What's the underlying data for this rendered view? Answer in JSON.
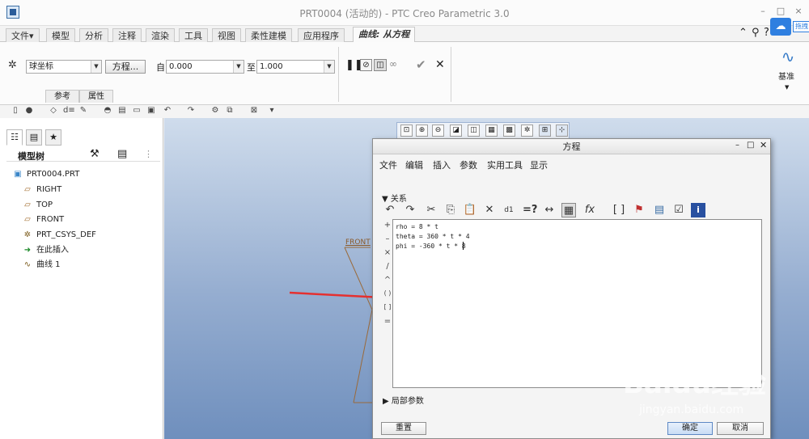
{
  "window": {
    "title": "PRT0004 (活动的) - PTC Creo Parametric 3.0",
    "controls": [
      "–",
      "□",
      "×"
    ]
  },
  "ribbon_tabs": [
    "文件▾",
    "模型",
    "分析",
    "注释",
    "渲染",
    "工具",
    "视图",
    "柔性建模",
    "应用程序",
    "曲线: 从方程"
  ],
  "corner_label": "拖拽",
  "ribbon": {
    "coord_system": "球坐标",
    "equation_button": "方程...",
    "from_label": "自",
    "from_value": "0.000",
    "to_label": "至",
    "to_value": "1.000",
    "subtabs": [
      "参考",
      "属性"
    ],
    "datum_label": "基准"
  },
  "model_tree": {
    "title": "模型树",
    "items": [
      {
        "icon": "part-icon",
        "label": "PRT0004.PRT"
      },
      {
        "icon": "plane-icon",
        "label": "RIGHT"
      },
      {
        "icon": "plane-icon",
        "label": "TOP"
      },
      {
        "icon": "plane-icon",
        "label": "FRONT"
      },
      {
        "icon": "csys-icon",
        "label": "PRT_CSYS_DEF"
      },
      {
        "icon": "insert-arrow-icon",
        "label": "在此插入"
      },
      {
        "icon": "curve-icon",
        "label": "曲线 1"
      }
    ]
  },
  "canvas": {
    "front_label": "FRONT"
  },
  "dialog": {
    "title": "方程",
    "menus": [
      "文件",
      "编辑",
      "插入",
      "参数",
      "实用工具",
      "显示"
    ],
    "section_relations": "关系",
    "operators": [
      "+",
      "–",
      "×",
      "/",
      "^",
      "( )",
      "[ ]",
      "="
    ],
    "equations": [
      "rho = 8 * t",
      "theta = 360 * t * 4",
      "phi = -360 * t * 8"
    ],
    "section_local": "局部参数",
    "reset_button": "重置",
    "ok_button": "确定",
    "cancel_button": "取消"
  },
  "watermark": {
    "brand": "Baidu经验",
    "url": "jingyan.baidu.com"
  }
}
